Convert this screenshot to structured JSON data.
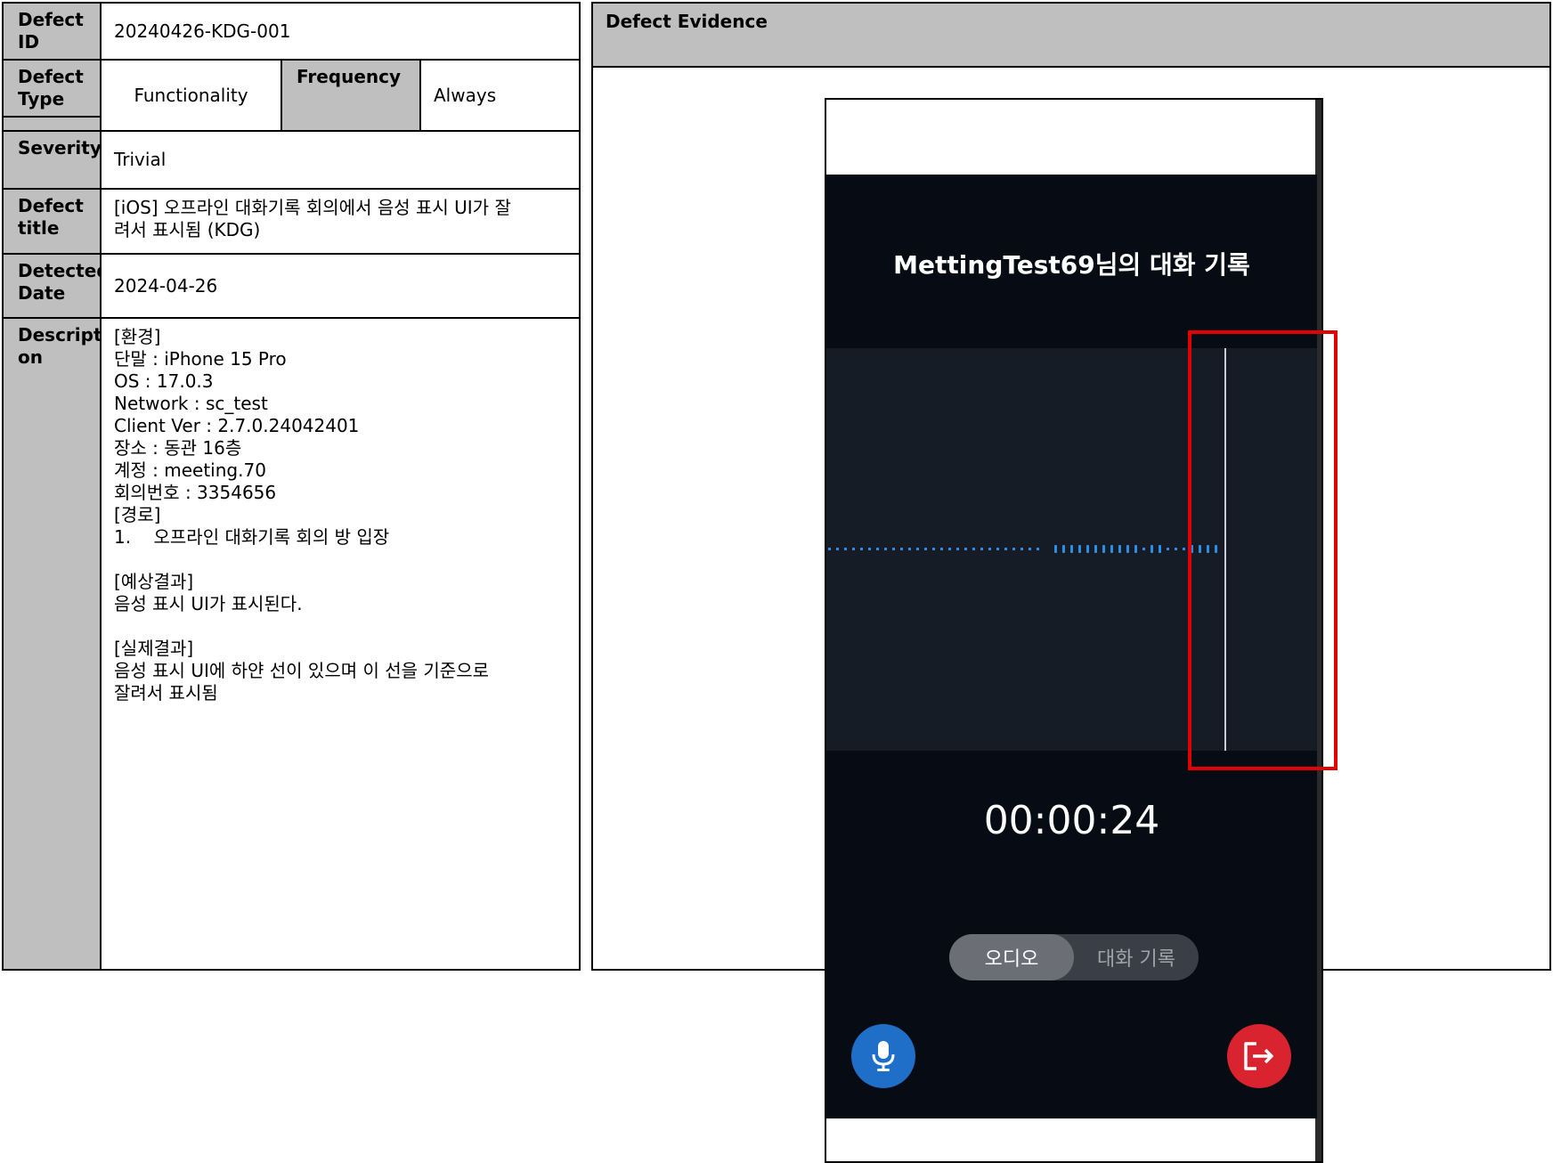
{
  "defect_table": {
    "id_label": "Defect\nID",
    "id_value": "20240426-KDG-001",
    "type_label": "Defect\nType",
    "type_value": "Functionality",
    "frequency_label": "Frequency",
    "frequency_value": "Always",
    "severity_label": "Severity",
    "severity_value": "Trivial",
    "title_label": "Defect\ntitle",
    "title_value": "[iOS] 오프라인 대화기록 회의에서 음성 표시 UI가 잘\n려서 표시됨 (KDG)",
    "date_label": "Detected\nDate",
    "date_value": "2024-04-26",
    "description_label": "Descripti\non",
    "description_value": "[환경]\n단말 : iPhone 15 Pro\nOS : 17.0.3\nNetwork : sc_test\nClient Ver : 2.7.0.24042401\n장소 : 동관 16층\n계정 : meeting.70\n회의번호 : 3354656\n[경로]\n1.    오프라인 대화기록 회의 방 입장\n\n[예상결과]\n음성 표시 UI가 표시된다.\n\n[실제결과]\n음성 표시 UI에 하얀 선이 있으며 이 선을 기준으로\n잘려서 표시됨"
  },
  "evidence": {
    "header": "Defect Evidence",
    "phone": {
      "title": "MettingTest69님의 대화 기록",
      "timer": "00:00:24",
      "tab_audio": "오디오",
      "tab_transcript": "대화 기록",
      "mic_icon": "mic-icon",
      "exit_icon": "exit-icon",
      "accent_color": "#1f6fc9",
      "exit_color": "#d9232e",
      "highlight_color": "#e50000"
    }
  }
}
